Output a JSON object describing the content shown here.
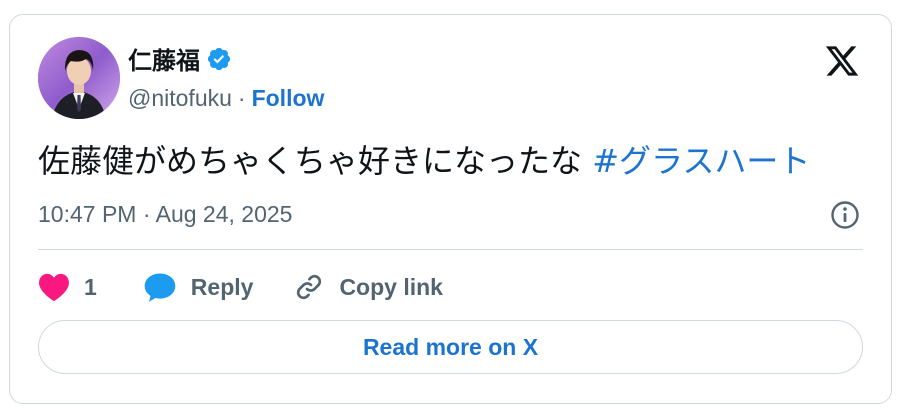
{
  "author": {
    "display_name": "仁藤福",
    "handle": "@nitofuku",
    "separator": "·",
    "follow_label": "Follow"
  },
  "tweet": {
    "text": "佐藤健がめちゃくちゃ好きになったな",
    "hashtag": "#グラスハート",
    "timestamp": "10:47 PM · Aug 24, 2025"
  },
  "actions": {
    "like_count": "1",
    "reply_label": "Reply",
    "copy_link_label": "Copy link"
  },
  "footer": {
    "read_more_label": "Read more on X"
  },
  "colors": {
    "accent": "#1d74d0",
    "like": "#f91880",
    "muted": "#536471",
    "border": "#cfd9de",
    "verified": "#1d9bf0"
  },
  "icons": [
    "verified-badge-icon",
    "x-logo-icon",
    "info-icon",
    "heart-icon",
    "reply-bubble-icon",
    "link-icon"
  ]
}
